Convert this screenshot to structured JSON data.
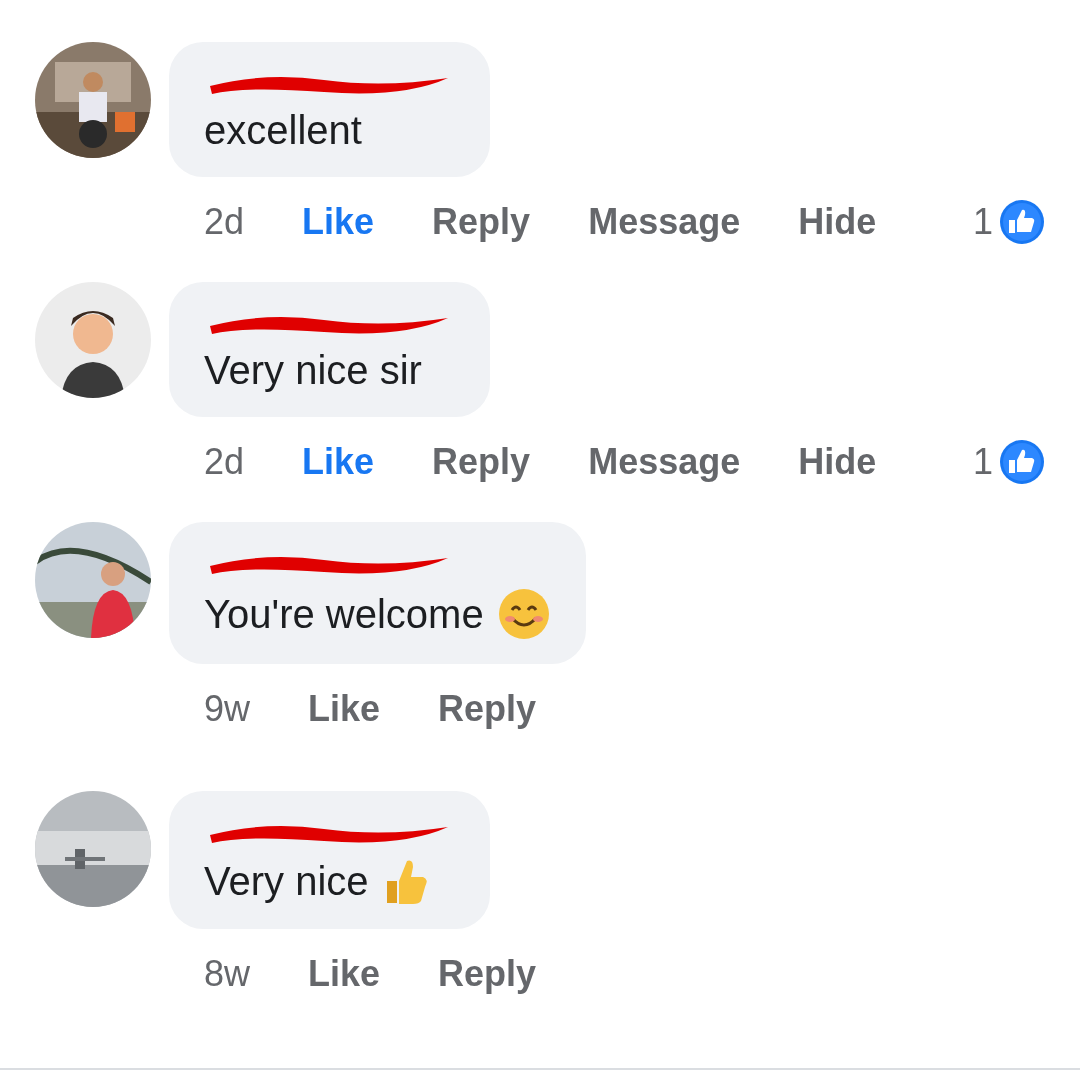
{
  "comments": [
    {
      "text": "excellent",
      "time": "2d",
      "liked": true,
      "actions": [
        "Like",
        "Reply",
        "Message",
        "Hide"
      ],
      "reactions": "1"
    },
    {
      "text": "Very nice sir",
      "time": "2d",
      "liked": true,
      "actions": [
        "Like",
        "Reply",
        "Message",
        "Hide"
      ],
      "reactions": "1"
    },
    {
      "text": "You're welcome",
      "emoji": {
        "kind": "smile"
      },
      "time": "9w",
      "liked": false,
      "actions": [
        "Like",
        "Reply"
      ]
    },
    {
      "text": "Very nice",
      "emoji": {
        "kind": "thumbs"
      },
      "time": "8w",
      "liked": false,
      "actions": [
        "Like",
        "Reply"
      ]
    }
  ]
}
